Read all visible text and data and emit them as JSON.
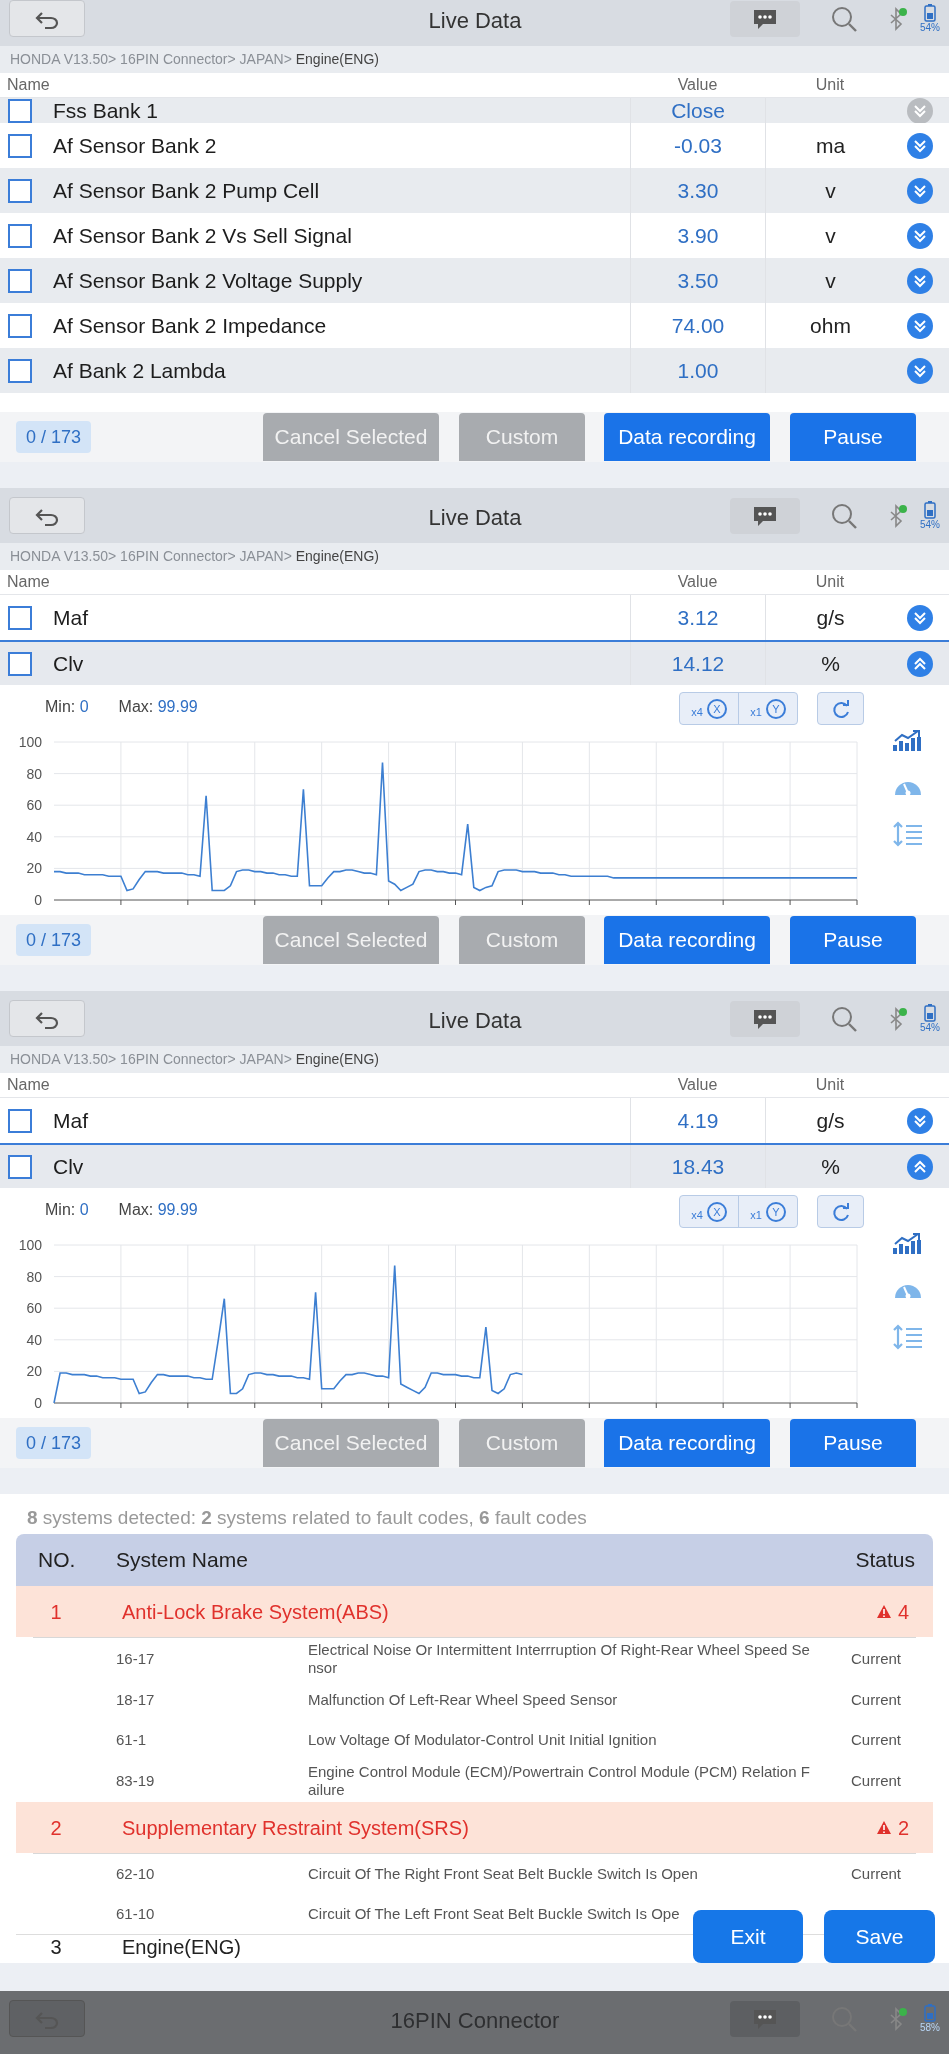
{
  "panels": [
    {
      "header": {
        "title": "Live Data",
        "battery": "54%",
        "dimmed": false
      },
      "breadcrumb": {
        "path": "HONDA V13.50> 16PIN Connector> JAPAN>",
        "current": "Engine(ENG)"
      },
      "columns": [
        "Name",
        "Value",
        "Unit"
      ],
      "cut_row": {
        "name": "Fss Bank 1",
        "value": "Close",
        "checked": false,
        "expanded": false,
        "disabled": true
      },
      "rows": [
        {
          "name": "Af Sensor Bank 2",
          "value": "-0.03",
          "unit": "ma",
          "checked": false,
          "expanded": false
        },
        {
          "name": "Af Sensor Bank 2 Pump Cell",
          "value": "3.30",
          "unit": "v",
          "checked": false,
          "expanded": false
        },
        {
          "name": "Af Sensor Bank 2 Vs Sell Signal",
          "value": "3.90",
          "unit": "v",
          "checked": false,
          "expanded": false
        },
        {
          "name": "Af Sensor Bank 2 Voltage Supply",
          "value": "3.50",
          "unit": "v",
          "checked": false,
          "expanded": false
        },
        {
          "name": "Af Sensor Bank 2 Impedance",
          "value": "74.00",
          "unit": "ohm",
          "checked": false,
          "expanded": false
        },
        {
          "name": "Af Bank 2 Lambda",
          "value": "1.00",
          "checked": false,
          "expanded": false
        }
      ],
      "footer": {
        "counter": "0 / 173",
        "buttons": [
          {
            "label": "Cancel Selected",
            "disabled": true
          },
          {
            "label": "Custom",
            "disabled": true
          },
          {
            "label": "Data recording",
            "disabled": false
          },
          {
            "label": "Pause",
            "disabled": false
          }
        ]
      }
    },
    {
      "header": {
        "title": "Live Data",
        "battery": "54%",
        "dimmed": false
      },
      "breadcrumb": {
        "path": "HONDA V13.50> 16PIN Connector> JAPAN>",
        "current": "Engine(ENG)"
      },
      "columns": [
        "Name",
        "Value",
        "Unit"
      ],
      "rows": [
        {
          "name": "Maf",
          "value": "3.12",
          "unit": "g/s",
          "checked": false,
          "expanded": false
        },
        {
          "name": "Clv",
          "value": "14.12",
          "unit": "%",
          "checked": false,
          "expanded": true
        }
      ],
      "graph": {
        "min_label": "Min:",
        "min": "0",
        "max_label": "Max:",
        "max": "99.99",
        "x_zoom": "x4",
        "x_axis": "X",
        "y_zoom": "x1",
        "y_axis": "Y",
        "chart_data": {
          "type": "line",
          "grid": true,
          "ylim": [
            0,
            100
          ],
          "yticks": [
            0,
            20,
            40,
            60,
            80,
            100
          ],
          "categories": [
            null,
            null,
            null,
            null,
            null,
            null,
            null,
            null,
            null,
            null,
            null,
            null,
            null,
            null,
            null,
            null,
            null,
            null,
            null,
            null,
            null,
            null,
            null,
            null,
            null,
            null,
            null,
            null,
            null,
            null,
            null,
            null,
            null,
            null,
            null,
            null,
            null,
            null,
            null,
            null,
            null,
            null,
            null,
            null,
            null,
            null,
            null,
            null,
            null,
            null,
            null,
            null,
            null,
            null,
            null,
            null,
            null,
            null,
            null,
            null,
            null,
            null,
            null,
            null,
            null,
            null,
            null,
            null,
            null,
            null,
            null,
            null,
            null,
            null,
            null,
            null,
            null,
            null,
            null,
            null,
            null,
            null,
            null,
            null,
            null,
            null,
            null,
            null,
            null,
            null,
            null,
            null,
            null,
            null,
            null,
            null,
            null,
            null,
            null,
            null,
            null,
            null,
            null,
            null,
            null,
            null,
            null,
            null,
            null,
            null,
            null,
            null,
            null,
            null,
            null,
            null,
            null,
            null,
            null,
            null,
            null,
            null,
            null,
            null,
            null,
            null,
            null,
            null,
            null,
            null,
            null,
            null,
            null
          ],
          "series": [
            {
              "color": "#3d7fd1",
              "values": [
                18,
                18,
                17,
                17,
                17,
                16,
                16,
                16,
                16,
                15,
                15,
                15,
                6,
                7,
                13,
                18,
                18,
                18,
                17,
                17,
                17,
                17,
                16,
                16,
                15,
                66,
                6,
                6,
                6,
                9,
                18,
                19,
                19,
                18,
                18,
                17,
                17,
                16,
                16,
                15,
                15,
                70,
                9,
                9,
                9,
                14,
                18,
                18,
                19,
                19,
                18,
                17,
                17,
                16,
                87,
                12,
                10,
                6,
                8,
                10,
                18,
                19,
                19,
                18,
                18,
                17,
                17,
                16,
                48,
                8,
                6,
                8,
                9,
                18,
                19,
                19,
                19,
                18,
                18,
                18,
                17,
                17,
                17,
                16,
                16,
                15,
                15,
                15,
                15,
                15,
                15,
                15,
                14,
                14,
                14,
                14,
                14,
                14,
                14,
                14,
                14,
                14,
                14,
                14,
                14,
                14,
                14,
                14,
                14,
                14,
                14,
                14,
                14,
                14,
                14,
                14,
                14,
                14,
                14,
                14,
                14,
                14,
                14,
                14,
                14,
                14,
                14,
                14,
                14,
                14,
                14,
                14,
                14
              ]
            }
          ]
        }
      },
      "footer": {
        "counter": "0 / 173",
        "buttons": [
          {
            "label": "Cancel Selected",
            "disabled": true
          },
          {
            "label": "Custom",
            "disabled": true
          },
          {
            "label": "Data recording",
            "disabled": false
          },
          {
            "label": "Pause",
            "disabled": false
          }
        ]
      }
    },
    {
      "header": {
        "title": "Live Data",
        "battery": "54%",
        "dimmed": false
      },
      "breadcrumb": {
        "path": "HONDA V13.50> 16PIN Connector> JAPAN>",
        "current": "Engine(ENG)"
      },
      "columns": [
        "Name",
        "Value",
        "Unit"
      ],
      "rows": [
        {
          "name": "Maf",
          "value": "4.19",
          "unit": "g/s",
          "checked": false,
          "expanded": false
        },
        {
          "name": "Clv",
          "value": "18.43",
          "unit": "%",
          "checked": false,
          "expanded": true
        }
      ],
      "graph": {
        "min_label": "Min:",
        "min": "0",
        "max_label": "Max:",
        "max": "99.99",
        "x_zoom": "x4",
        "x_axis": "X",
        "y_zoom": "x1",
        "y_axis": "Y",
        "chart_data": {
          "type": "line",
          "grid": true,
          "ylim": [
            0,
            100
          ],
          "yticks": [
            0,
            20,
            40,
            60,
            80,
            100
          ],
          "categories": [
            null,
            null,
            null,
            null,
            null,
            null,
            null,
            null,
            null,
            null,
            null,
            null,
            null,
            null,
            null,
            null,
            null,
            null,
            null,
            null,
            null,
            null,
            null,
            null,
            null,
            null,
            null,
            null,
            null,
            null,
            null,
            null,
            null,
            null,
            null,
            null,
            null,
            null,
            null,
            null,
            null,
            null,
            null,
            null,
            null,
            null,
            null,
            null,
            null,
            null,
            null,
            null,
            null,
            null,
            null,
            null,
            null,
            null,
            null,
            null,
            null,
            null,
            null,
            null,
            null,
            null,
            null,
            null,
            null,
            null,
            null,
            null,
            null,
            null,
            null,
            null,
            null,
            null,
            null,
            null,
            null,
            null,
            null,
            null,
            null,
            null,
            null,
            null,
            null,
            null,
            null,
            null,
            null,
            null,
            null,
            null,
            null,
            null,
            null,
            null,
            null,
            null,
            null,
            null,
            null,
            null,
            null,
            null,
            null,
            null,
            null,
            null,
            null,
            null,
            null,
            null,
            null,
            null,
            null,
            null,
            null,
            null,
            null,
            null,
            null,
            null,
            null,
            null,
            null,
            null,
            null,
            null,
            null
          ],
          "series": [
            {
              "color": "#3d7fd1",
              "values": [
                0,
                19,
                19,
                18,
                18,
                18,
                17,
                17,
                16,
                16,
                16,
                15,
                15,
                15,
                6,
                7,
                13,
                18,
                18,
                17,
                17,
                17,
                17,
                16,
                16,
                15,
                15,
                40,
                66,
                6,
                6,
                9,
                18,
                19,
                19,
                18,
                18,
                17,
                17,
                17,
                16,
                16,
                15,
                70,
                9,
                9,
                9,
                14,
                18,
                18,
                19,
                19,
                18,
                17,
                17,
                16,
                87,
                12,
                10,
                8,
                6,
                10,
                19,
                19,
                18,
                18,
                18,
                17,
                17,
                16,
                16,
                48,
                8,
                6,
                9,
                18,
                19,
                18,
                null,
                null,
                null,
                null,
                null,
                null,
                null,
                null,
                null,
                null,
                null,
                null,
                null,
                null,
                null,
                null,
                null,
                null,
                null,
                null,
                null,
                null,
                null,
                null,
                null,
                null,
                null,
                null,
                null,
                null,
                null,
                null,
                null,
                null,
                null,
                null,
                null,
                null,
                null,
                null,
                null,
                null,
                null,
                null,
                null,
                null,
                null,
                null,
                null,
                null,
                null,
                null,
                null,
                null,
                null
              ]
            }
          ]
        }
      },
      "footer": {
        "counter": "0 / 173",
        "buttons": [
          {
            "label": "Cancel Selected",
            "disabled": true
          },
          {
            "label": "Custom",
            "disabled": true
          },
          {
            "label": "Data recording",
            "disabled": false
          },
          {
            "label": "Pause",
            "disabled": false
          }
        ]
      }
    }
  ],
  "report": {
    "summary": "**8** systems detected: **2** systems related to fault codes, **6** fault codes",
    "columns": [
      "NO.",
      "System Name",
      "Status"
    ],
    "systems": [
      {
        "no": "1",
        "name": "Anti-Lock Brake System(ABS)",
        "count": "4",
        "faults": [
          {
            "code": "16-17",
            "description": "Electrical Noise Or Intermittent Interrruption Of Right-Rear Wheel Speed Sensor",
            "status": "Current"
          },
          {
            "code": "18-17",
            "description": "Malfunction Of Left-Rear Wheel Speed Sensor",
            "status": "Current"
          },
          {
            "code": "61-1",
            "description": "Low Voltage Of Modulator-Control Unit Initial Ignition",
            "status": "Current"
          },
          {
            "code": "83-19",
            "description": "Engine Control Module (ECM)/Powertrain Control Module (PCM) Relation Failure",
            "status": "Current"
          }
        ]
      },
      {
        "no": "2",
        "name": "Supplementary Restraint System(SRS)",
        "count": "2",
        "faults": [
          {
            "code": "62-10",
            "description": "Circuit Of The Right Front Seat Belt Buckle Switch Is Open",
            "status": "Current"
          },
          {
            "code": "61-10",
            "description": "Circuit Of The Left Front Seat Belt Buckle Switch Is Ope"
          }
        ]
      },
      {
        "no": "3",
        "name": "Engine(ENG)"
      }
    ],
    "buttons": [
      "Exit",
      "Save"
    ]
  },
  "next_header": {
    "title": "16PIN Connector",
    "battery": "58%",
    "dimmed": true
  }
}
